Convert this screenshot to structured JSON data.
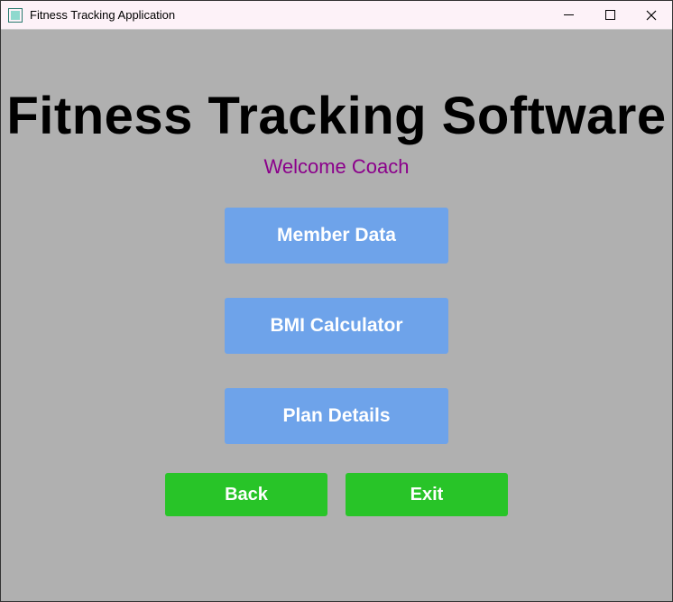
{
  "window": {
    "title": "Fitness Tracking Application"
  },
  "main": {
    "heading": "Fitness Tracking Software",
    "welcome": "Welcome Coach"
  },
  "buttons": {
    "member_data": "Member Data",
    "bmi_calculator": "BMI Calculator",
    "plan_details": "Plan Details",
    "back": "Back",
    "exit": "Exit"
  },
  "colors": {
    "content_bg": "#b0b0b0",
    "primary_btn": "#6ea3ea",
    "secondary_btn": "#28c428",
    "welcome_text": "#8b008b"
  }
}
